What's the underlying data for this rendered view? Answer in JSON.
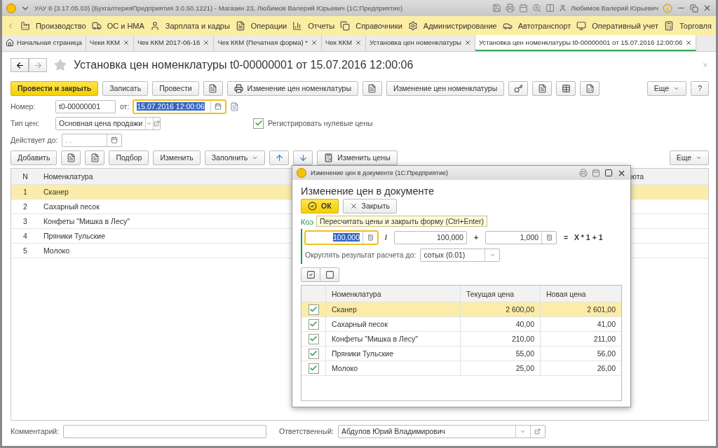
{
  "window": {
    "title": "УАУ 8 (3.17.05.03) (БухгалтерияПредприятия 3.0.50.1221) - Магазин 23, Любимов Валерий Юрьевич  (1С:Предприятие)",
    "user": "Любимов Валерий Юрьевич"
  },
  "sections": [
    "Производство",
    "ОС и НМА",
    "Зарплата и кадры",
    "Операции",
    "Отчеты",
    "Справочники",
    "Администрирование",
    "Автотранспорт",
    "Оперативный учет",
    "Торговля"
  ],
  "tabs": [
    {
      "label": "Начальная страница",
      "selected": false,
      "closable": false
    },
    {
      "label": "Чеки ККМ",
      "selected": false,
      "closable": true
    },
    {
      "label": "Чек ККМ 2017-06-16",
      "selected": false,
      "closable": true
    },
    {
      "label": "Чек ККМ (Печатная форма) *",
      "selected": false,
      "closable": true
    },
    {
      "label": "Чек ККМ",
      "selected": false,
      "closable": true
    },
    {
      "label": "Установка цен номенклатуры",
      "selected": false,
      "closable": true
    },
    {
      "label": "Установка цен номенклатуры t0-00000001 от 15.07.2016 12:00:06",
      "selected": true,
      "closable": true
    }
  ],
  "document": {
    "title": "Установка цен номенклатуры t0-00000001 от 15.07.2016 12:00:06",
    "commands": [
      {
        "kind": "primary",
        "label": "Провести и закрыть"
      },
      {
        "kind": "plain",
        "label": "Записать"
      },
      {
        "kind": "plain",
        "label": "Провести"
      },
      {
        "kind": "icon"
      },
      {
        "kind": "print",
        "label": "Изменение цен номенклатуры"
      },
      {
        "kind": "icon"
      },
      {
        "kind": "plain",
        "label": "Изменение цен номенклатуры"
      },
      {
        "kind": "icon"
      },
      {
        "kind": "icon"
      },
      {
        "kind": "icon"
      },
      {
        "kind": "icon"
      }
    ],
    "more": "Еще",
    "help": "?",
    "number_label": "Номер:",
    "number": "t0-00000001",
    "date_label": "от:",
    "date": "15.07.2016 12:00:06",
    "price_type_label": "Тип цен:",
    "price_type": "Основная цена продажи",
    "zero_prices": {
      "label": "Регистрировать нулевые цены",
      "checked": true
    },
    "valid_until_label": "Действует до:",
    "valid_until_placeholder": ".   ."
  },
  "table_toolbar": [
    {
      "kind": "plain",
      "label": "Добавить"
    },
    {
      "kind": "icon"
    },
    {
      "kind": "icon"
    },
    {
      "kind": "plain",
      "label": "Подбор"
    },
    {
      "kind": "plain",
      "label": "Изменить"
    },
    {
      "kind": "menu",
      "label": "Заполнить"
    },
    {
      "kind": "up"
    },
    {
      "kind": "down"
    },
    {
      "kind": "calc",
      "label": "Изменить цены"
    }
  ],
  "table_more": "Еще",
  "table": {
    "columns": [
      "N",
      "Номенклатура",
      "юта"
    ],
    "rows": [
      {
        "n": "1",
        "name": "Сканер",
        "selected": true
      },
      {
        "n": "2",
        "name": "Сахарный песок",
        "selected": false
      },
      {
        "n": "3",
        "name": "Конфеты \"Мишка в Лесу\"",
        "selected": false
      },
      {
        "n": "4",
        "name": "Пряники Тульские",
        "selected": false
      },
      {
        "n": "5",
        "name": "Молоко",
        "selected": false
      }
    ]
  },
  "footer": {
    "comment_label": "Комментарий:",
    "responsible_label": "Ответственный:",
    "responsible": "Абдулов Юрий Владимирович"
  },
  "dialog": {
    "title": "Изменение цен в документе  (1С:Предприятие)",
    "heading": "Изменение цен в документе",
    "ok": "ОК",
    "close": "Закрыть",
    "tooltip": "Пересчитать цены и закрыть форму (Ctrl+Enter)",
    "coef_label": "Коэ",
    "multiplier": "100,000",
    "div": "/",
    "divisor": "100,000",
    "plus": "+",
    "addend": "1,000",
    "formula": "=   X * 1 + 1",
    "round_label": "Округлять результат расчета до:",
    "round_value": "сотых (0.01)",
    "columns": [
      "Номенклатура",
      "Текущая цена",
      "Новая цена"
    ],
    "rows": [
      {
        "checked": true,
        "name": "Сканер",
        "current": "2 600,00",
        "new": "2 601,00",
        "selected": true
      },
      {
        "checked": true,
        "name": "Сахарный песок",
        "current": "40,00",
        "new": "41,00",
        "selected": false
      },
      {
        "checked": true,
        "name": "Конфеты \"Мишка в Лесу\"",
        "current": "210,00",
        "new": "211,00",
        "selected": false
      },
      {
        "checked": true,
        "name": "Пряники Тульские",
        "current": "55,00",
        "new": "56,00",
        "selected": false
      },
      {
        "checked": true,
        "name": "Молоко",
        "current": "25,00",
        "new": "26,00",
        "selected": false
      }
    ]
  }
}
